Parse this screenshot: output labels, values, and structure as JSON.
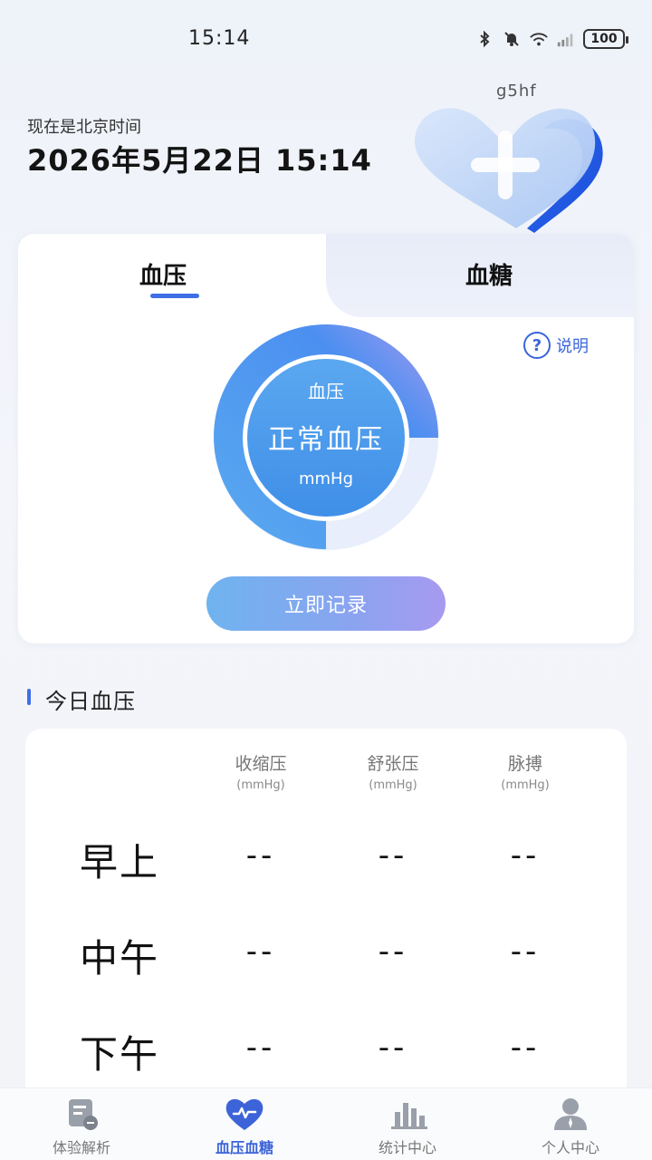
{
  "status_bar": {
    "time": "15:14",
    "battery": "100"
  },
  "header": {
    "time_caption": "现在是北京时间",
    "datetime": "2026年5月22日 15:14",
    "app_id": "g5hf"
  },
  "tabs": {
    "blood_pressure": "血压",
    "blood_sugar": "血糖"
  },
  "help": {
    "label": "说明"
  },
  "gauge": {
    "title": "血压",
    "status": "正常血压",
    "unit": "mmHg"
  },
  "record_button": "立即记录",
  "today_section": {
    "title": "今日血压",
    "columns": [
      {
        "name": "收缩压",
        "unit": "(mmHg)"
      },
      {
        "name": "舒张压",
        "unit": "(mmHg)"
      },
      {
        "name": "脉搏",
        "unit": "(mmHg)"
      }
    ],
    "rows": [
      {
        "label": "早上",
        "values": [
          "--",
          "--",
          "--"
        ]
      },
      {
        "label": "中午",
        "values": [
          "--",
          "--",
          "--"
        ]
      },
      {
        "label": "下午",
        "values": [
          "--",
          "--",
          "--"
        ]
      }
    ]
  },
  "bottom_nav": [
    {
      "label": "体验解析",
      "icon": "report-icon"
    },
    {
      "label": "血压血糖",
      "icon": "heart-wave-icon"
    },
    {
      "label": "统计中心",
      "icon": "bar-chart-icon"
    },
    {
      "label": "个人中心",
      "icon": "person-icon"
    }
  ],
  "colors": {
    "accent": "#3f6fe6",
    "gauge_blue": "#4a9ef0",
    "gauge_purple": "#a49af0"
  }
}
